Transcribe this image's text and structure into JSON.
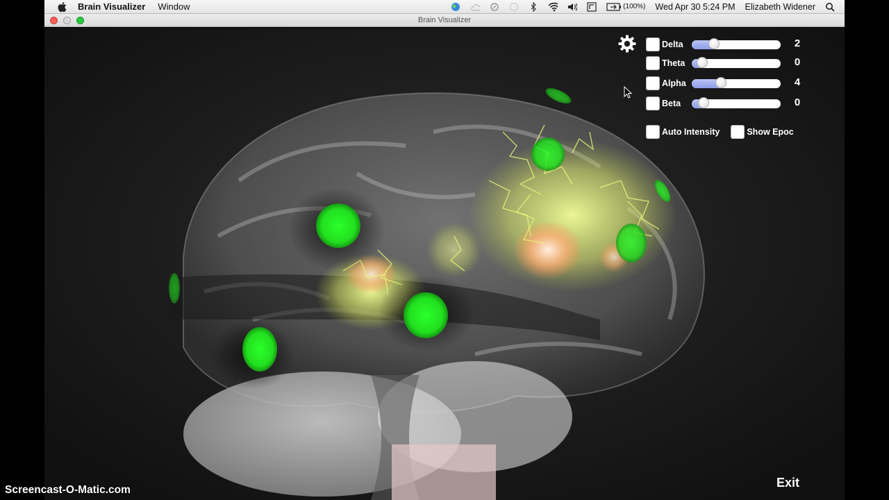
{
  "menubar": {
    "app_name": "Brain Visualizer",
    "menus": [
      "Window"
    ],
    "battery": "(100%)",
    "clock": "Wed Apr 30  5:24 PM",
    "user": "Elizabeth Widener",
    "icons": [
      "apple-icon",
      "status-app-icon",
      "cloud-icon",
      "sync-icon",
      "timemachine-icon",
      "bluetooth-icon",
      "wifi-icon",
      "volume-icon",
      "input-icon",
      "battery-icon",
      "search-icon"
    ]
  },
  "window": {
    "title": "Brain Visualizer"
  },
  "controls": {
    "bands": [
      {
        "label": "Delta",
        "value": "2",
        "level": 0.25
      },
      {
        "label": "Theta",
        "value": "0",
        "level": 0.12
      },
      {
        "label": "Alpha",
        "value": "4",
        "level": 0.33
      },
      {
        "label": "Beta",
        "value": "0",
        "level": 0.13
      }
    ],
    "auto_intensity_label": "Auto Intensity",
    "show_epoc_label": "Show Epoc"
  },
  "exit_label": "Exit",
  "watermark": "Screencast-O-Matic.com",
  "colors": {
    "electrode": "#22e01f",
    "activity": "#e6f27a",
    "hotspot": "#ffb07a",
    "slider_fill": "#9aa9ee"
  }
}
